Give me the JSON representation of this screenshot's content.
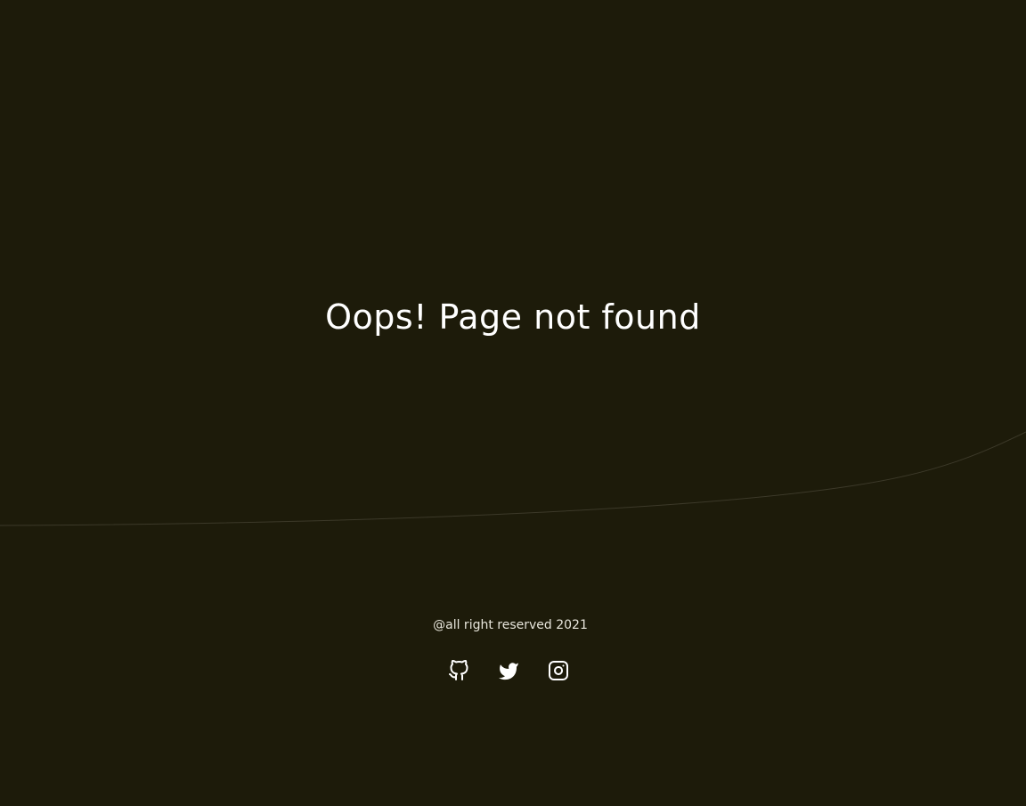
{
  "theme": {
    "background": "#1d1b0a",
    "curve_stroke": "#3c3929",
    "text": "#ffffff"
  },
  "error": {
    "message": "Oops! Page not found"
  },
  "footer": {
    "copyright": "@all right reserved 2021",
    "social_links": [
      {
        "icon": "github-icon"
      },
      {
        "icon": "twitter-icon"
      },
      {
        "icon": "instagram-icon"
      }
    ]
  }
}
